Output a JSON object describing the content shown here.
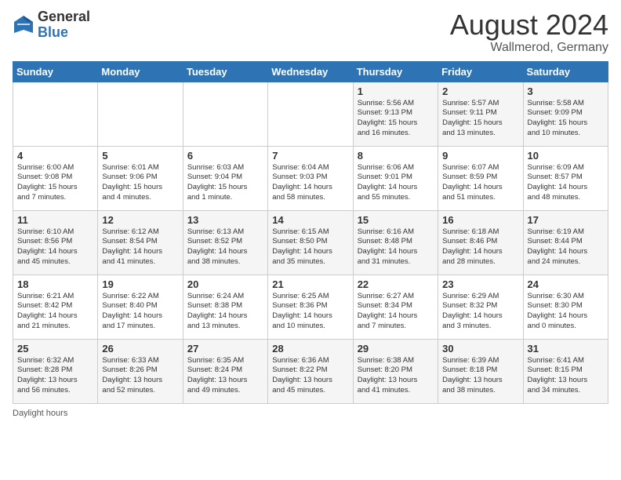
{
  "header": {
    "logo_general": "General",
    "logo_blue": "Blue",
    "month_title": "August 2024",
    "location": "Wallmerod, Germany"
  },
  "days_of_week": [
    "Sunday",
    "Monday",
    "Tuesday",
    "Wednesday",
    "Thursday",
    "Friday",
    "Saturday"
  ],
  "footer": {
    "daylight_label": "Daylight hours"
  },
  "weeks": [
    [
      {
        "day": "",
        "info": ""
      },
      {
        "day": "",
        "info": ""
      },
      {
        "day": "",
        "info": ""
      },
      {
        "day": "",
        "info": ""
      },
      {
        "day": "1",
        "info": "Sunrise: 5:56 AM\nSunset: 9:13 PM\nDaylight: 15 hours\nand 16 minutes."
      },
      {
        "day": "2",
        "info": "Sunrise: 5:57 AM\nSunset: 9:11 PM\nDaylight: 15 hours\nand 13 minutes."
      },
      {
        "day": "3",
        "info": "Sunrise: 5:58 AM\nSunset: 9:09 PM\nDaylight: 15 hours\nand 10 minutes."
      }
    ],
    [
      {
        "day": "4",
        "info": "Sunrise: 6:00 AM\nSunset: 9:08 PM\nDaylight: 15 hours\nand 7 minutes."
      },
      {
        "day": "5",
        "info": "Sunrise: 6:01 AM\nSunset: 9:06 PM\nDaylight: 15 hours\nand 4 minutes."
      },
      {
        "day": "6",
        "info": "Sunrise: 6:03 AM\nSunset: 9:04 PM\nDaylight: 15 hours\nand 1 minute."
      },
      {
        "day": "7",
        "info": "Sunrise: 6:04 AM\nSunset: 9:03 PM\nDaylight: 14 hours\nand 58 minutes."
      },
      {
        "day": "8",
        "info": "Sunrise: 6:06 AM\nSunset: 9:01 PM\nDaylight: 14 hours\nand 55 minutes."
      },
      {
        "day": "9",
        "info": "Sunrise: 6:07 AM\nSunset: 8:59 PM\nDaylight: 14 hours\nand 51 minutes."
      },
      {
        "day": "10",
        "info": "Sunrise: 6:09 AM\nSunset: 8:57 PM\nDaylight: 14 hours\nand 48 minutes."
      }
    ],
    [
      {
        "day": "11",
        "info": "Sunrise: 6:10 AM\nSunset: 8:56 PM\nDaylight: 14 hours\nand 45 minutes."
      },
      {
        "day": "12",
        "info": "Sunrise: 6:12 AM\nSunset: 8:54 PM\nDaylight: 14 hours\nand 41 minutes."
      },
      {
        "day": "13",
        "info": "Sunrise: 6:13 AM\nSunset: 8:52 PM\nDaylight: 14 hours\nand 38 minutes."
      },
      {
        "day": "14",
        "info": "Sunrise: 6:15 AM\nSunset: 8:50 PM\nDaylight: 14 hours\nand 35 minutes."
      },
      {
        "day": "15",
        "info": "Sunrise: 6:16 AM\nSunset: 8:48 PM\nDaylight: 14 hours\nand 31 minutes."
      },
      {
        "day": "16",
        "info": "Sunrise: 6:18 AM\nSunset: 8:46 PM\nDaylight: 14 hours\nand 28 minutes."
      },
      {
        "day": "17",
        "info": "Sunrise: 6:19 AM\nSunset: 8:44 PM\nDaylight: 14 hours\nand 24 minutes."
      }
    ],
    [
      {
        "day": "18",
        "info": "Sunrise: 6:21 AM\nSunset: 8:42 PM\nDaylight: 14 hours\nand 21 minutes."
      },
      {
        "day": "19",
        "info": "Sunrise: 6:22 AM\nSunset: 8:40 PM\nDaylight: 14 hours\nand 17 minutes."
      },
      {
        "day": "20",
        "info": "Sunrise: 6:24 AM\nSunset: 8:38 PM\nDaylight: 14 hours\nand 13 minutes."
      },
      {
        "day": "21",
        "info": "Sunrise: 6:25 AM\nSunset: 8:36 PM\nDaylight: 14 hours\nand 10 minutes."
      },
      {
        "day": "22",
        "info": "Sunrise: 6:27 AM\nSunset: 8:34 PM\nDaylight: 14 hours\nand 7 minutes."
      },
      {
        "day": "23",
        "info": "Sunrise: 6:29 AM\nSunset: 8:32 PM\nDaylight: 14 hours\nand 3 minutes."
      },
      {
        "day": "24",
        "info": "Sunrise: 6:30 AM\nSunset: 8:30 PM\nDaylight: 14 hours\nand 0 minutes."
      }
    ],
    [
      {
        "day": "25",
        "info": "Sunrise: 6:32 AM\nSunset: 8:28 PM\nDaylight: 13 hours\nand 56 minutes."
      },
      {
        "day": "26",
        "info": "Sunrise: 6:33 AM\nSunset: 8:26 PM\nDaylight: 13 hours\nand 52 minutes."
      },
      {
        "day": "27",
        "info": "Sunrise: 6:35 AM\nSunset: 8:24 PM\nDaylight: 13 hours\nand 49 minutes."
      },
      {
        "day": "28",
        "info": "Sunrise: 6:36 AM\nSunset: 8:22 PM\nDaylight: 13 hours\nand 45 minutes."
      },
      {
        "day": "29",
        "info": "Sunrise: 6:38 AM\nSunset: 8:20 PM\nDaylight: 13 hours\nand 41 minutes."
      },
      {
        "day": "30",
        "info": "Sunrise: 6:39 AM\nSunset: 8:18 PM\nDaylight: 13 hours\nand 38 minutes."
      },
      {
        "day": "31",
        "info": "Sunrise: 6:41 AM\nSunset: 8:15 PM\nDaylight: 13 hours\nand 34 minutes."
      }
    ]
  ]
}
